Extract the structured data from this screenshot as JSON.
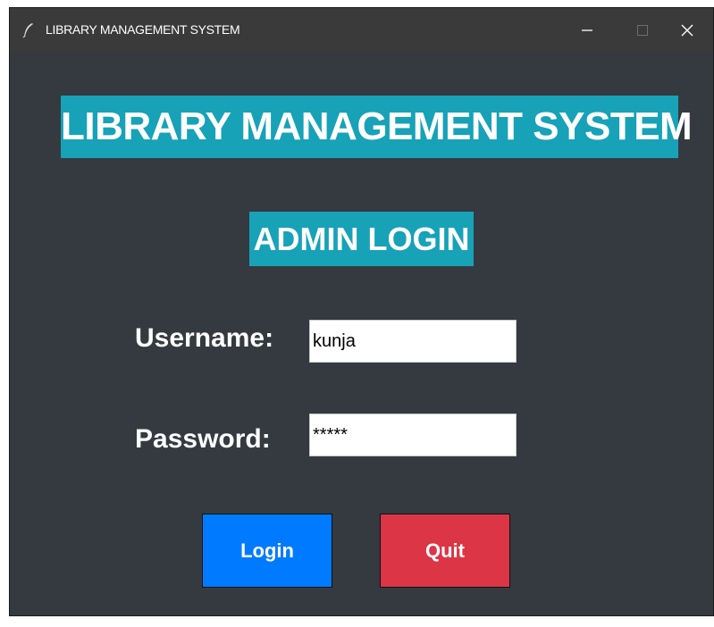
{
  "window": {
    "title": "LIBRARY MANAGEMENT SYSTEM",
    "app_icon": "feather-icon",
    "controls": {
      "minimize": "–",
      "maximize": "□",
      "close": "✕"
    }
  },
  "main": {
    "heading": "LIBRARY MANAGEMENT SYSTEM",
    "subheading": "ADMIN LOGIN"
  },
  "form": {
    "username_label": "Username:",
    "username_value": "kunja",
    "password_label": "Password:",
    "password_value": "*****"
  },
  "buttons": {
    "login": "Login",
    "quit": "Quit"
  },
  "colors": {
    "background": "#343a40",
    "banner": "#17a2b8",
    "login": "#007bff",
    "quit": "#dc3545"
  }
}
